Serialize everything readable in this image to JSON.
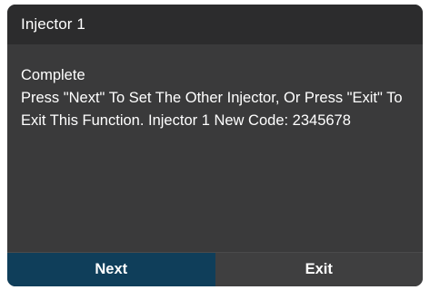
{
  "dialog": {
    "title": "Injector 1",
    "message_status": "Complete",
    "message_body": "Press \"Next\" To Set The Other Injector, Or Press \"Exit\" To Exit This Function. Injector 1 New Code: 2345678",
    "buttons": {
      "next_label": "Next",
      "exit_label": "Exit"
    }
  },
  "colors": {
    "titlebar": "#2c2c2d",
    "body": "#3a3a3b",
    "next_button": "#0f3e5a",
    "exit_button": "#3f3f40",
    "text": "#ffffff"
  }
}
